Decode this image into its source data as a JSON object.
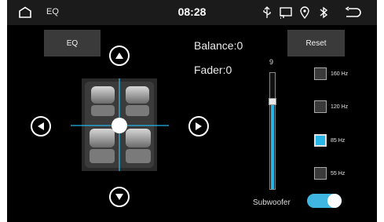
{
  "status_bar": {
    "app_title": "EQ",
    "time": "08:28",
    "icons": [
      "home-icon",
      "usb-icon",
      "screen-mirror-icon",
      "location-icon",
      "bluetooth-icon",
      "back-icon"
    ]
  },
  "buttons": {
    "eq_label": "EQ",
    "reset_label": "Reset"
  },
  "readouts": {
    "balance": "Balance:0",
    "fader": "Fader:0"
  },
  "slider": {
    "value_label": "9",
    "level_fraction": 0.75
  },
  "frequencies": [
    {
      "label": "160 Hz",
      "checked": false
    },
    {
      "label": "120 Hz",
      "checked": false
    },
    {
      "label": "85 Hz",
      "checked": true
    },
    {
      "label": "55 Hz",
      "checked": false
    }
  ],
  "subwoofer": {
    "label": "Subwoofer",
    "enabled": true
  },
  "colors": {
    "accent": "#29b4e6",
    "background": "#000000",
    "statusbar": "#1b1b1b"
  }
}
